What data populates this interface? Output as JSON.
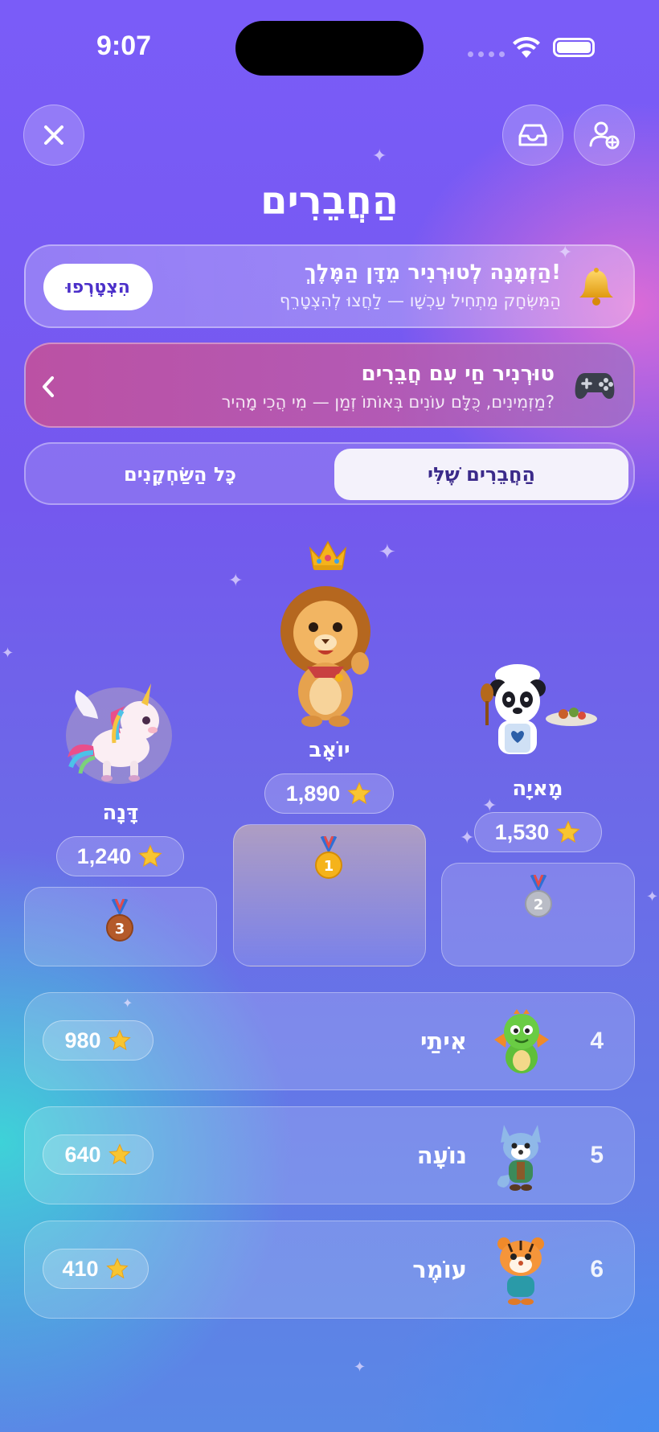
{
  "status_bar": {
    "time": "9:07"
  },
  "header": {
    "title": "הַחֲבֵרִים"
  },
  "invite_banner": {
    "title": "הַזְמָנָה לְטוּרְנִיר מֵדָּן הַמֶּלֶךְ!",
    "subtitle": "הַמִּשְׂחָק מַתְחִיל עַכְשָׁו — לַחֲצוּ לְהִצְטָרֵף",
    "button_label": "הִצְטָרְפוּ",
    "icon": "bell-icon"
  },
  "live_banner": {
    "title": "טוּרְנִיר חַי עִם חֲבֵרִים",
    "subtitle": "מַזְמִינִים, כֻּלָּם עוֹנִים בְּאוֹתוֹ זְמַן — מִי הֲכִי מָהִיר?",
    "icon": "gamepad-icon"
  },
  "tabs": {
    "active": "הַחֲבֵרִים שֶׁלִּי",
    "inactive": "כָּל הַשַּׂחְקָנִים"
  },
  "podium": {
    "first": {
      "name": "יוֹאָב",
      "score": "1,890",
      "medal": "1",
      "avatar": "lion-icon"
    },
    "second": {
      "name": "מָאיָה",
      "score": "1,530",
      "medal": "2",
      "avatar": "panda-icon"
    },
    "third": {
      "name": "דָּנָה",
      "score": "1,240",
      "medal": "3",
      "avatar": "unicorn-icon"
    }
  },
  "leaderboard": [
    {
      "rank": "4",
      "name": "אִיתַי",
      "score": "980",
      "avatar": "dragon-icon"
    },
    {
      "rank": "5",
      "name": "נוֹעָה",
      "score": "640",
      "avatar": "fox-icon"
    },
    {
      "rank": "6",
      "name": "עוֹמֶר",
      "score": "410",
      "avatar": "tiger-icon"
    }
  ],
  "colors": {
    "accent": "#4b2fc9",
    "star": "#f8c531",
    "gold": "#f5b31b",
    "silver": "#b9bcc6",
    "bronze": "#b45a2a"
  }
}
